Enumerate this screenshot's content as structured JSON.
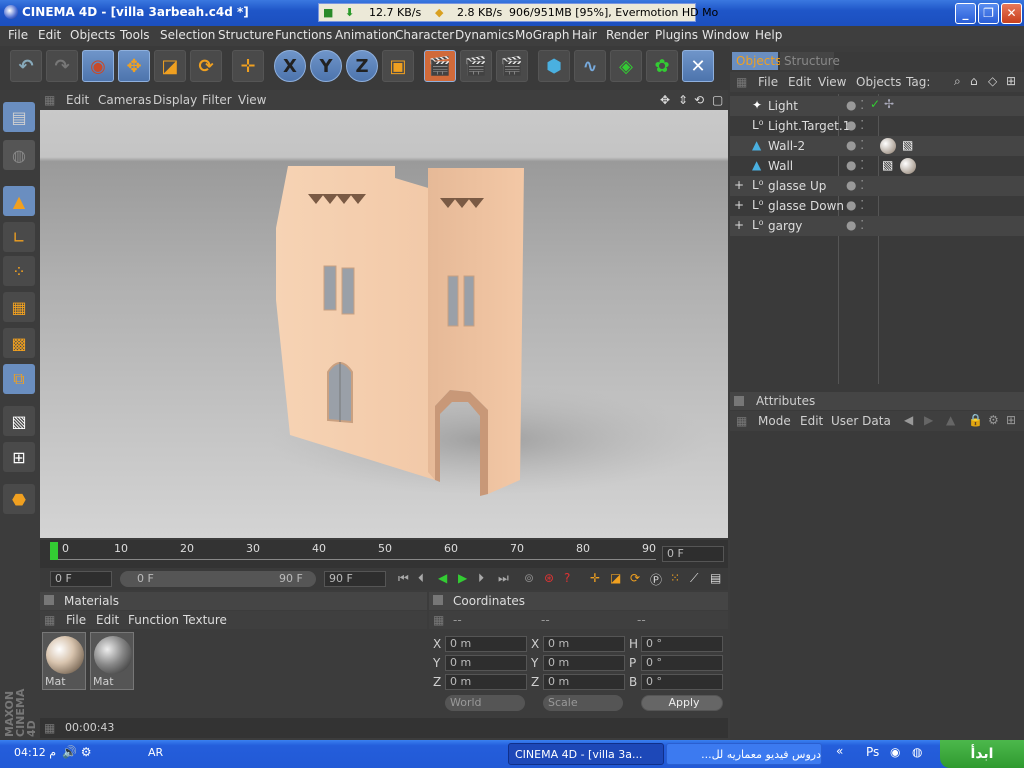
{
  "window": {
    "title": "CINEMA 4D - [villa 3arbeah.c4d *]"
  },
  "download": {
    "down_speed": "12.7 KB/s",
    "up_speed": "2.8 KB/s",
    "progress_text": "906/951MB [95%], Evermotion HD Mo"
  },
  "menu": [
    "File",
    "Edit",
    "Objects",
    "Tools",
    "Selection",
    "Structure",
    "Functions",
    "Animation",
    "Character",
    "Dynamics",
    "MoGraph",
    "Hair",
    "Render",
    "Plugins",
    "Window",
    "Help"
  ],
  "toolbar_icons": [
    "undo-icon",
    "redo-icon",
    "live-select-icon",
    "move-icon",
    "scale-icon",
    "rotate-icon",
    "create-icon",
    "x-axis-icon",
    "y-axis-icon",
    "z-axis-icon",
    "coordinate-system-icon",
    "render-view-icon",
    "render-picture-viewer-icon",
    "render-settings-icon",
    "cube-icon",
    "spline-icon",
    "nurbs-icon",
    "array-icon",
    "deformer-icon"
  ],
  "axes": {
    "x": "X",
    "y": "Y",
    "z": "Z"
  },
  "viewport_menu": [
    "Edit",
    "Cameras",
    "Display",
    "Filter",
    "View"
  ],
  "timeline": {
    "ticks": [
      "0",
      "10",
      "20",
      "30",
      "40",
      "50",
      "60",
      "70",
      "80",
      "90"
    ],
    "current_frame": "0 F",
    "start": "0 F",
    "range_start": "0 F",
    "range_end": "90 F",
    "end": "90 F"
  },
  "materials": {
    "title": "Materials",
    "menu": [
      "File",
      "Edit",
      "Function",
      "Texture"
    ],
    "items": [
      {
        "name": "Mat"
      },
      {
        "name": "Mat"
      }
    ]
  },
  "coordinates": {
    "title": "Coordinates",
    "col1": "--",
    "col2": "--",
    "col3": "--",
    "rows": [
      {
        "l1": "X",
        "v1": "0 m",
        "l2": "X",
        "v2": "0 m",
        "l3": "H",
        "v3": "0 °"
      },
      {
        "l1": "Y",
        "v1": "0 m",
        "l2": "Y",
        "v2": "0 m",
        "l3": "P",
        "v3": "0 °"
      },
      {
        "l1": "Z",
        "v1": "0 m",
        "l2": "Z",
        "v2": "0 m",
        "l3": "B",
        "v3": "0 °"
      }
    ],
    "mode": "World",
    "size": "Scale",
    "apply": "Apply"
  },
  "status_time": "00:00:43",
  "objects_panel": {
    "tabs": [
      "Objects",
      "Structure"
    ],
    "menu": [
      "File",
      "Edit",
      "View",
      "Objects",
      "Tag:"
    ],
    "items": [
      {
        "name": "Light",
        "indent": 0
      },
      {
        "name": "Light.Target.1",
        "indent": 0
      },
      {
        "name": "Wall-2",
        "indent": 0
      },
      {
        "name": "Wall",
        "indent": 0
      },
      {
        "name": "glasse Up",
        "indent": 0,
        "expand": "+"
      },
      {
        "name": "glasse Down",
        "indent": 0,
        "expand": "+"
      },
      {
        "name": "gargy",
        "indent": 0,
        "expand": "+"
      }
    ]
  },
  "attributes": {
    "title": "Attributes",
    "menu": [
      "Mode",
      "Edit",
      "User Data"
    ]
  },
  "brand": "MAXON CINEMA 4D",
  "taskbar": {
    "clock": "04:12 م",
    "lang": "AR",
    "tasks": [
      "CINEMA 4D - [villa 3a...",
      "دروس فيديو معماريه لل..."
    ],
    "start": "ابدأ"
  }
}
